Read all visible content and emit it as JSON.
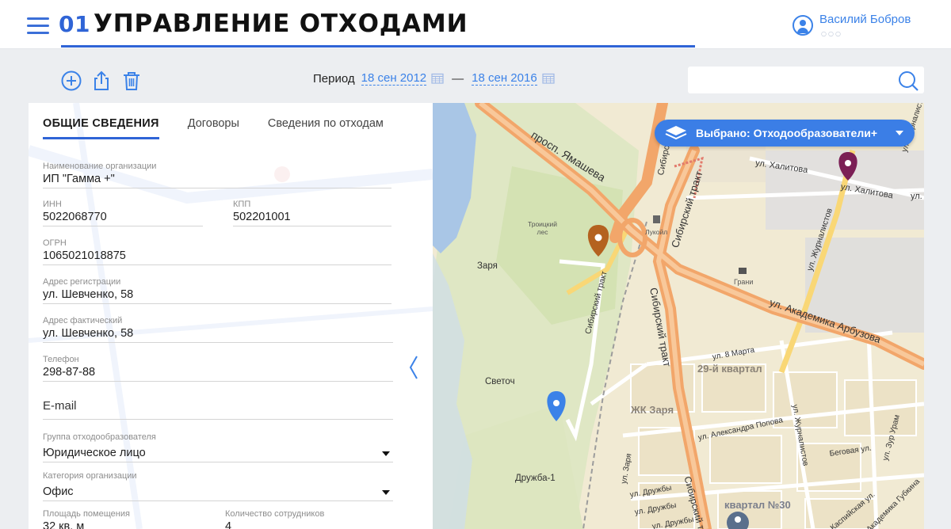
{
  "header": {
    "number": "01",
    "title": "УПРАВЛЕНИЕ ОТХОДАМИ",
    "user_name": "Василий Бобров",
    "user_dots": "○○○"
  },
  "toolbar": {
    "add_icon": "plus-circle-icon",
    "export_icon": "share-upload-icon",
    "delete_icon": "trash-icon",
    "period_label": "Период",
    "date_from": "18 сен 2012",
    "date_to": "18 сен 2016",
    "date_separator": "—",
    "search_placeholder": "",
    "search_icon": "search-icon"
  },
  "tabs": [
    {
      "label": "ОБЩИЕ СВЕДЕНИЯ",
      "active": true
    },
    {
      "label": "Договоры",
      "active": false
    },
    {
      "label": "Сведения по отходам",
      "active": false
    }
  ],
  "form": {
    "org_name": {
      "label": "Наименование организации",
      "value": "ИП \"Гамма +\""
    },
    "inn": {
      "label": "ИНН",
      "value": "5022068770"
    },
    "kpp": {
      "label": "КПП",
      "value": "502201001"
    },
    "ogrn": {
      "label": "ОГРН",
      "value": "1065021018875"
    },
    "reg_address": {
      "label": "Адрес регистрации",
      "value": "ул. Шевченко, 58"
    },
    "fact_address": {
      "label": "Адрес фактический",
      "value": "ул. Шевченко, 58"
    },
    "phone": {
      "label": "Телефон",
      "value": "298-87-88"
    },
    "email": {
      "label": "",
      "placeholder": "E-mail"
    },
    "group": {
      "label": "Группа отходообразователя",
      "value": "Юридическое лицо"
    },
    "category": {
      "label": "Категория организации",
      "value": "Офис"
    },
    "area": {
      "label": "Площадь помещения",
      "value": "32 кв. м"
    },
    "employees": {
      "label": "Количество сотрудников",
      "value": "4"
    }
  },
  "map": {
    "layer_button": "Выбрано: Отходообразователи+",
    "layer_icon": "layers-icon",
    "labels": {
      "yamasheva": "просп. Ямашева",
      "sibirsky1": "Сибирский тракт",
      "sibirsky2": "Сибирский тракт",
      "sibirsky3": "Сибирский тракт",
      "sibirsky4": "Сибирский тракт",
      "sibirsky5": "Сибирский",
      "khalitova1": "ул. Халитова",
      "khalitova2": "ул. Халитова",
      "ul": "ул.",
      "arbuzova": "ул. Академика Арбузова",
      "zhurnalistov1": "ул. Журналистов",
      "zhurnalistov2": "ул. Журналистов",
      "zhurnalistov3": "ул. Журналистов",
      "troitsky": "Троицкий\nлес",
      "lukoil": "Лукойл",
      "grani": "Грани",
      "zarya": "Заря",
      "svetoch": "Светоч",
      "march8": "ул. 8 Марта",
      "kv29": "29-й квартал",
      "zhk_zarya": "ЖК Заря",
      "popova": "ул. Александра Попова",
      "begovaya": "Беговая ул.",
      "zur_ural": "ул. Зур Урам",
      "druzhba1": "Дружба-1",
      "druzhby1": "ул. Дружбы",
      "druzhby2": "ул. Дружбы",
      "druzhby3": "ул. Дружбы",
      "ul_zarya": "ул. Заря",
      "kv30": "квартал №30",
      "kaspiyskaya": "Каспийская ул.",
      "gubkina": "ул. Академика Губкина"
    },
    "markers": {
      "purple": "#7b1f55",
      "brown": "#b4621f",
      "blue": "#3b82e8",
      "gray": "#5a6f8c"
    }
  },
  "colors": {
    "accent": "#2f64d6",
    "link": "#3b82e8"
  }
}
